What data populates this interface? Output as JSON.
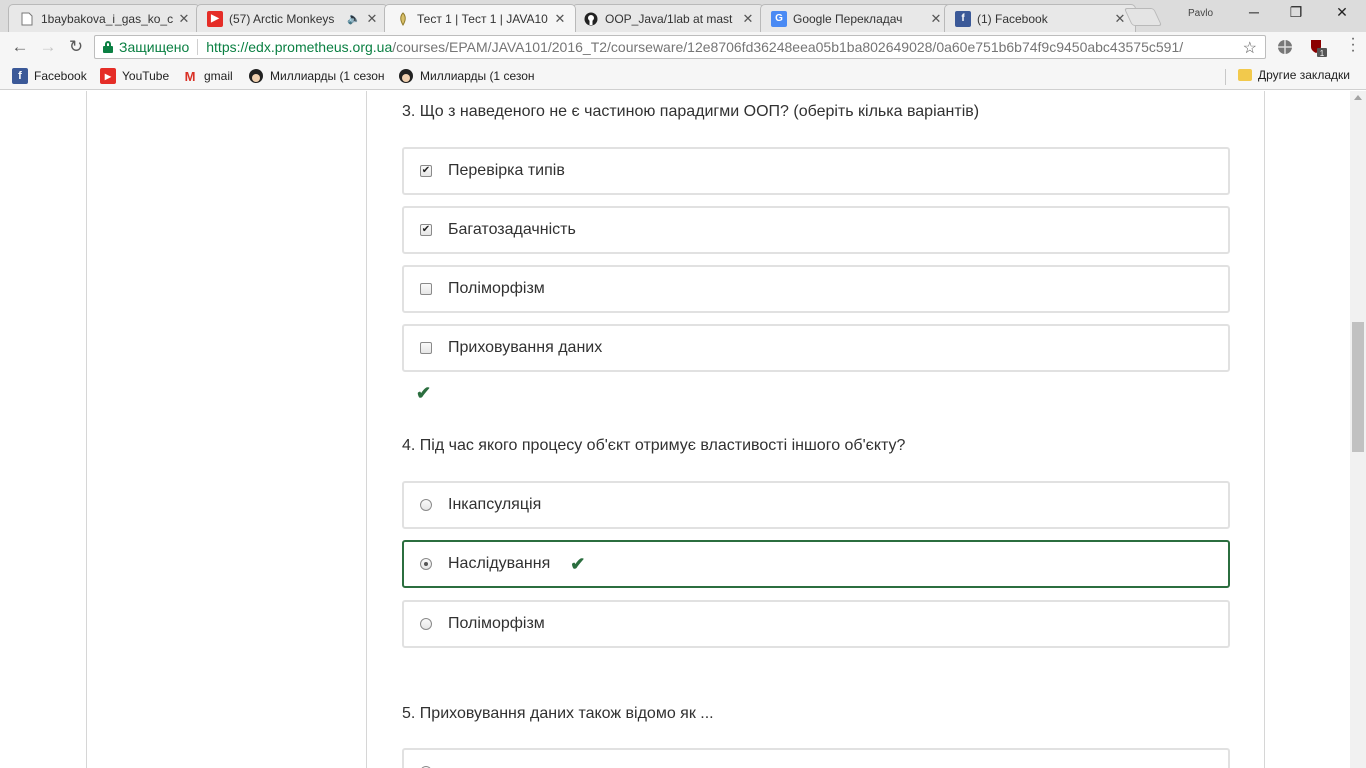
{
  "browser": {
    "profile_name": "Pavlo",
    "tabs": [
      {
        "title": "1baybakova_i_gas_ko_c",
        "icon": "document-icon"
      },
      {
        "title": "(57) Arctic Monkeys",
        "icon": "youtube-icon",
        "audio": "🔈"
      },
      {
        "title": "Тест 1 | Тест 1 | JAVA10",
        "icon": "prometheus-icon"
      },
      {
        "title": "OOP_Java/1lab at mast",
        "icon": "github-icon"
      },
      {
        "title": "Google Перекладач",
        "icon": "google-translate-icon"
      },
      {
        "title": "(1) Facebook",
        "icon": "facebook-icon"
      }
    ],
    "address": {
      "secure_label": "Защищено",
      "url_host": "https://edx.prometheus.org.ua",
      "url_rest": "/courses/EPAM/JAVA101/2016_T2/courseware/12e8706fd36248eea05b1ba802649028/0a60e751b6b74f9c9450abc43575c591/"
    },
    "bookmarks": [
      {
        "label": "Facebook",
        "icon": "facebook-icon"
      },
      {
        "label": "YouTube",
        "icon": "youtube-icon"
      },
      {
        "label": "gmail",
        "icon": "gmail-icon"
      },
      {
        "label": "Миллиарды (1 сезон",
        "icon": "avatar-icon"
      },
      {
        "label": "Миллиарды (1 сезон",
        "icon": "avatar-icon"
      }
    ],
    "other_bookmarks": "Другие закладки",
    "extension_badge": "1"
  },
  "quiz": {
    "q3": {
      "text": "3. Що з наведеного не є частиною парадигми ООП? (оберіть кілька варіантів)",
      "options": [
        {
          "label": "Перевірка типів",
          "checked": true
        },
        {
          "label": "Багатозадачність",
          "checked": true
        },
        {
          "label": "Поліморфізм",
          "checked": false
        },
        {
          "label": "Приховування даних",
          "checked": false
        }
      ],
      "status": "correct"
    },
    "q4": {
      "text": "4. Під час якого процесу об'єкт отримує властивості іншого об'єкту?",
      "options": [
        {
          "label": "Інкапсуляція",
          "selected": false
        },
        {
          "label": "Наслідування",
          "selected": true
        },
        {
          "label": "Поліморфізм",
          "selected": false
        }
      ]
    },
    "q5": {
      "text": "5. Приховування даних також відомо як ..."
    }
  },
  "colors": {
    "correct_green": "#2b6e3f",
    "secure_green": "#0b8043",
    "border_gray": "#e1e1e1"
  }
}
